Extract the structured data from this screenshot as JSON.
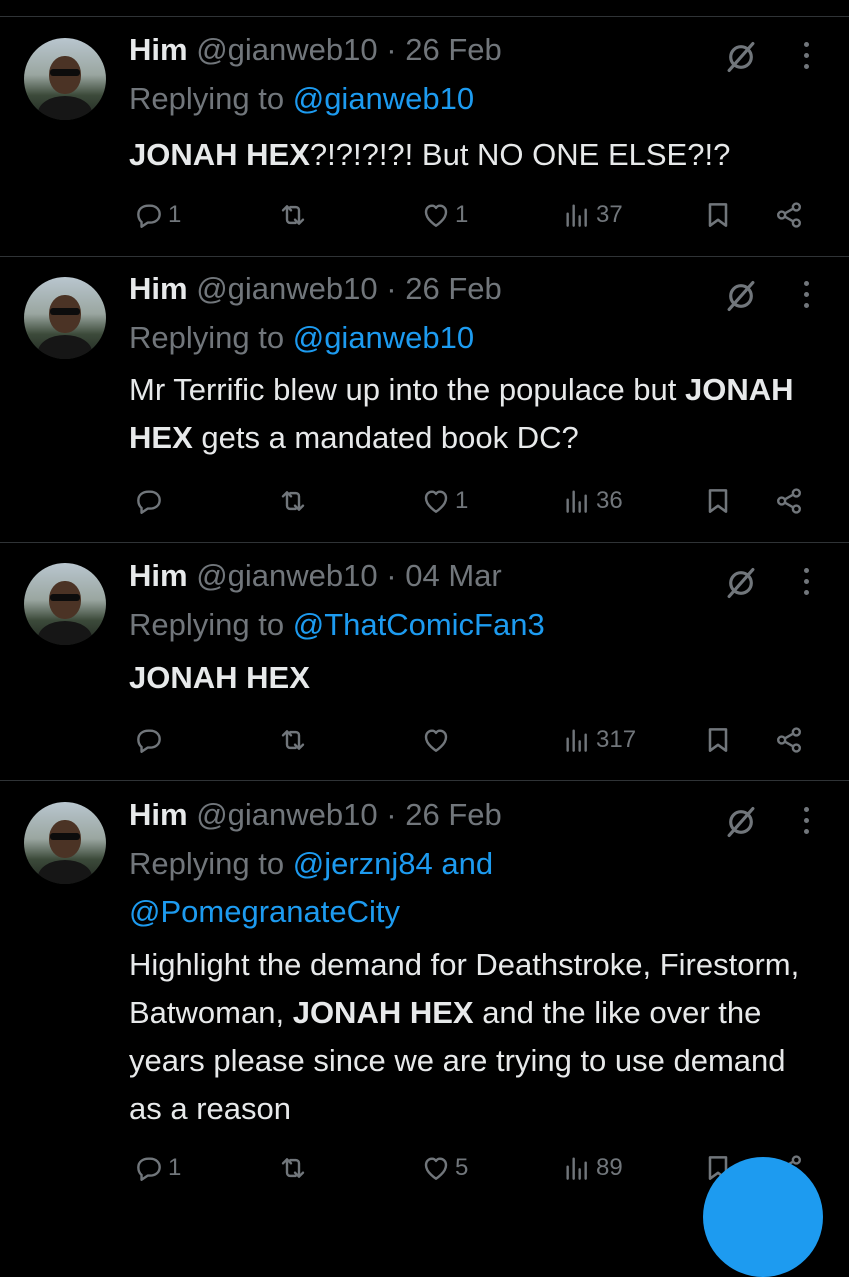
{
  "tweets": [
    {
      "name": "Him",
      "handle": "@gianweb10",
      "sep": "·",
      "date": "26 Feb",
      "replying_prefix": "Replying to",
      "replying_to": "@gianweb10",
      "body": [
        {
          "t": "JONAH HEX",
          "b": true
        },
        {
          "t": "?!?!?!?! But NO ONE ELSE?!?",
          "b": false
        }
      ],
      "replies": "1",
      "reposts": "",
      "likes": "1",
      "views": "37"
    },
    {
      "name": "Him",
      "handle": "@gianweb10",
      "sep": "·",
      "date": "26 Feb",
      "replying_prefix": "Replying to",
      "replying_to": "@gianweb10",
      "body": [
        {
          "t": "Mr Terrific blew up into the populace but ",
          "b": false
        },
        {
          "t": "JONAH HEX",
          "b": true
        },
        {
          "t": " gets a mandated book DC?",
          "b": false
        }
      ],
      "replies": "",
      "reposts": "",
      "likes": "1",
      "views": "36"
    },
    {
      "name": "Him",
      "handle": "@gianweb10",
      "sep": "·",
      "date": "04 Mar",
      "replying_prefix": "Replying to",
      "replying_to": "@ThatComicFan3",
      "body": [
        {
          "t": "JONAH HEX",
          "b": true
        }
      ],
      "replies": "",
      "reposts": "",
      "likes": "",
      "views": "317"
    },
    {
      "name": "Him",
      "handle": "@gianweb10",
      "sep": "·",
      "date": "26 Feb",
      "replying_prefix": "Replying to",
      "replying_to": "@jerznj84 and @PomegranateCity",
      "body": [
        {
          "t": "Highlight the demand for Deathstroke, Firestorm, Batwoman, ",
          "b": false
        },
        {
          "t": "JONAH HEX",
          "b": true
        },
        {
          "t": " and the like over the years please since we are trying to use demand as a reason",
          "b": false
        }
      ],
      "replies": "1",
      "reposts": "",
      "likes": "5",
      "views": "89"
    }
  ],
  "colors": {
    "background": "#000000",
    "text": "#e7e9ea",
    "muted": "#71767b",
    "link": "#1d9bf0",
    "divider": "#2f3336"
  },
  "icons": [
    "grok-icon",
    "more-icon",
    "reply-icon",
    "repost-icon",
    "like-icon",
    "views-icon",
    "bookmark-icon",
    "share-icon"
  ]
}
